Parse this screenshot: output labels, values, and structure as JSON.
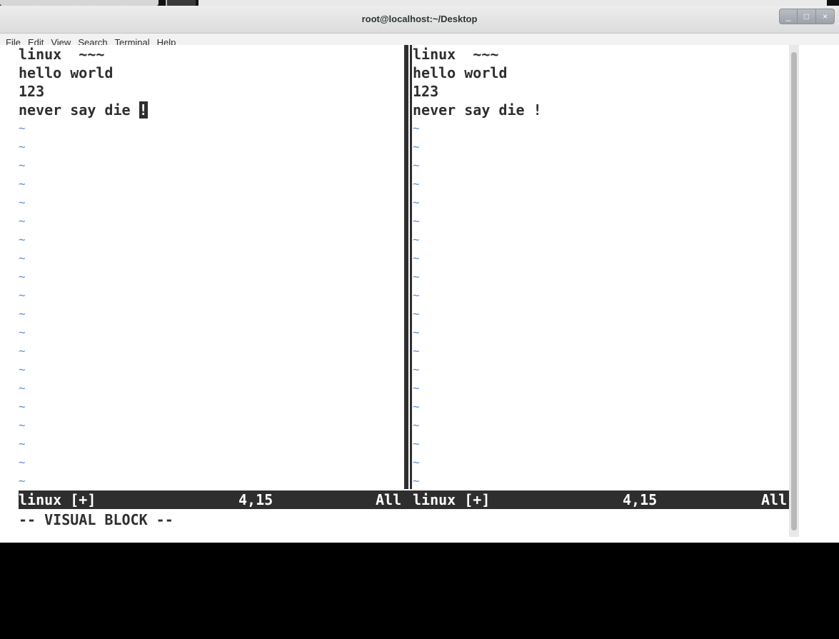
{
  "window": {
    "title": "root@localhost:~/Desktop",
    "buttons": {
      "minimize": "_",
      "maximize": "□",
      "close": "×"
    }
  },
  "menu": [
    "File",
    "Edit",
    "View",
    "Search",
    "Terminal",
    "Help"
  ],
  "left_pane": {
    "lines": [
      "linux  ~~~",
      "hello world",
      "123",
      "never say die "
    ],
    "cursor_char": "!"
  },
  "right_pane": {
    "lines": [
      "linux  ~~~",
      "hello world",
      "123",
      "never say die !"
    ]
  },
  "tilde": "~",
  "status": {
    "left_name": "linux [+]",
    "left_pos": "4,15",
    "left_scroll": "All",
    "right_name": "linux [+]",
    "right_pos": "4,15",
    "right_scroll": "All"
  },
  "mode": "-- VISUAL BLOCK --",
  "colors": {
    "tilde": "#5b8fd9",
    "status_bg": "#2e2e2e",
    "text": "#2e2e2e"
  }
}
